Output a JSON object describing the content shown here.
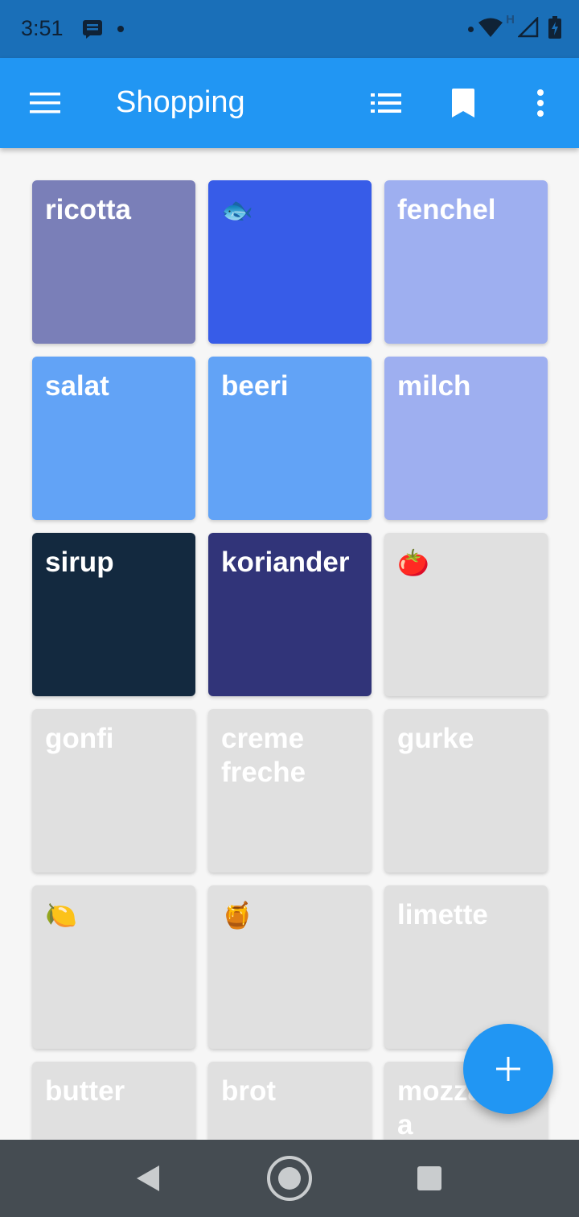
{
  "status_bar": {
    "time": "3:51",
    "network_label": "H"
  },
  "app_bar": {
    "title": "Shopping",
    "color": "#2196f3"
  },
  "tiles": [
    {
      "label": "ricotta",
      "color": "#7a7fb8"
    },
    {
      "label": "🐟",
      "color": "#375ce8",
      "emoji": true
    },
    {
      "label": "fenchel",
      "color": "#9eaff0"
    },
    {
      "label": "salat",
      "color": "#62a3f6"
    },
    {
      "label": "beeri",
      "color": "#62a3f6"
    },
    {
      "label": "milch",
      "color": "#9eaff0"
    },
    {
      "label": "sirup",
      "color": "#13293f"
    },
    {
      "label": "koriander",
      "color": "#313479"
    },
    {
      "label": "🍅",
      "color": "#e0e0e0",
      "emoji": true,
      "inactive": true
    },
    {
      "label": "gonfi",
      "color": "#e0e0e0",
      "inactive": true
    },
    {
      "label": "creme freche",
      "color": "#e0e0e0",
      "inactive": true
    },
    {
      "label": "gurke",
      "color": "#e0e0e0",
      "inactive": true
    },
    {
      "label": "🍋",
      "color": "#e0e0e0",
      "emoji": true,
      "inactive": true
    },
    {
      "label": "🍯",
      "color": "#e0e0e0",
      "emoji": true,
      "inactive": true
    },
    {
      "label": "limette",
      "color": "#e0e0e0",
      "inactive": true
    },
    {
      "label": "butter",
      "color": "#e0e0e0",
      "inactive": true
    },
    {
      "label": "brot",
      "color": "#e0e0e0",
      "inactive": true
    },
    {
      "label": "mozzarella",
      "color": "#e0e0e0",
      "inactive": true
    }
  ],
  "fab": {
    "icon": "plus-icon"
  },
  "nav_bar": {
    "icons": [
      "back-icon",
      "home-icon",
      "recents-icon"
    ]
  }
}
